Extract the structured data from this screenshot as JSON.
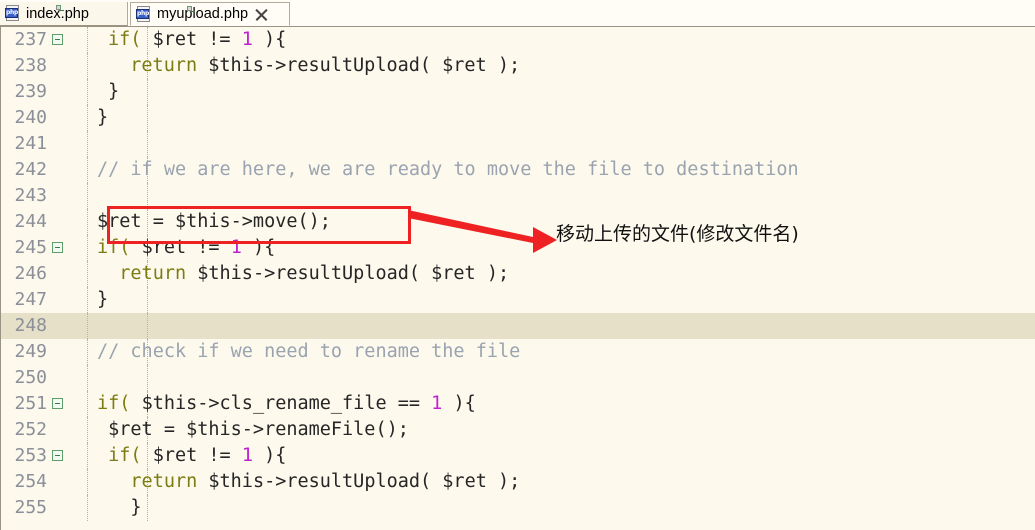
{
  "tabs": [
    {
      "label": "index.php",
      "icon": "php-file-icon",
      "active": false,
      "closable": false
    },
    {
      "label": "myupload.php",
      "icon": "php-file-icon",
      "active": true,
      "closable": true,
      "close_icon": "close-icon"
    }
  ],
  "icon_badge_text": "php",
  "editor": {
    "language": "php",
    "first_line": 237,
    "highlighted_line": 248,
    "colors": {
      "background": "#fdf9ed",
      "highlight_row": "#e7e0c9",
      "line_number": "#8a8f99",
      "keyword": "#7c7c13",
      "number": "#c020d0",
      "comment": "#9aa3b0",
      "plain": "#262626",
      "fold_marker": "#5f9e6a"
    },
    "lines": [
      {
        "n": "237",
        "fold": true,
        "hl": false,
        "indent": 1,
        "tokens": [
          {
            "t": "if( ",
            "c": "kw"
          },
          {
            "t": "$ret ",
            "c": "pl"
          },
          {
            "t": "!= ",
            "c": "pl"
          },
          {
            "t": "1",
            "c": "num"
          },
          {
            "t": " ){",
            "c": "pl"
          }
        ]
      },
      {
        "n": "238",
        "fold": false,
        "hl": false,
        "indent": 1,
        "tokens": [
          {
            "t": "  ",
            "c": "pl"
          },
          {
            "t": "return ",
            "c": "kw"
          },
          {
            "t": "$this->resultUpload( $ret );",
            "c": "pl"
          }
        ]
      },
      {
        "n": "239",
        "fold": false,
        "hl": false,
        "indent": 1,
        "tokens": [
          {
            "t": "}",
            "c": "pl"
          }
        ]
      },
      {
        "n": "240",
        "fold": false,
        "hl": false,
        "indent": 0,
        "tokens": [
          {
            "t": "}",
            "c": "pl"
          }
        ]
      },
      {
        "n": "241",
        "fold": false,
        "hl": false,
        "indent": 0,
        "tokens": [
          {
            "t": "",
            "c": "pl"
          }
        ]
      },
      {
        "n": "242",
        "fold": false,
        "hl": false,
        "indent": 0,
        "tokens": [
          {
            "t": "// if we are here, we are ready to move the file to destination",
            "c": "cmt"
          }
        ]
      },
      {
        "n": "243",
        "fold": false,
        "hl": false,
        "indent": 0,
        "tokens": [
          {
            "t": "",
            "c": "pl"
          }
        ]
      },
      {
        "n": "244",
        "fold": false,
        "hl": false,
        "indent": 0,
        "tokens": [
          {
            "t": "$ret = $this->move();",
            "c": "pl"
          }
        ]
      },
      {
        "n": "245",
        "fold": true,
        "hl": false,
        "indent": 0,
        "tokens": [
          {
            "t": "if( ",
            "c": "kw"
          },
          {
            "t": "$ret ",
            "c": "pl"
          },
          {
            "t": "!= ",
            "c": "pl"
          },
          {
            "t": "1",
            "c": "num"
          },
          {
            "t": " ){",
            "c": "pl"
          }
        ]
      },
      {
        "n": "246",
        "fold": false,
        "hl": false,
        "indent": 0,
        "tokens": [
          {
            "t": "  ",
            "c": "pl"
          },
          {
            "t": "return ",
            "c": "kw"
          },
          {
            "t": "$this->resultUpload( $ret );",
            "c": "pl"
          }
        ]
      },
      {
        "n": "247",
        "fold": false,
        "hl": false,
        "indent": 0,
        "tokens": [
          {
            "t": "}",
            "c": "pl"
          }
        ]
      },
      {
        "n": "248",
        "fold": false,
        "hl": true,
        "indent": 0,
        "tokens": [
          {
            "t": "",
            "c": "pl"
          }
        ]
      },
      {
        "n": "249",
        "fold": false,
        "hl": false,
        "indent": 0,
        "tokens": [
          {
            "t": "// check if we need to rename the file",
            "c": "cmt"
          }
        ]
      },
      {
        "n": "250",
        "fold": false,
        "hl": false,
        "indent": 0,
        "tokens": [
          {
            "t": "",
            "c": "pl"
          }
        ]
      },
      {
        "n": "251",
        "fold": true,
        "hl": false,
        "indent": 0,
        "tokens": [
          {
            "t": "if( ",
            "c": "kw"
          },
          {
            "t": "$this->cls_rename_file ",
            "c": "pl"
          },
          {
            "t": "== ",
            "c": "pl"
          },
          {
            "t": "1",
            "c": "num"
          },
          {
            "t": " ){",
            "c": "pl"
          }
        ]
      },
      {
        "n": "252",
        "fold": false,
        "hl": false,
        "indent": 0,
        "tokens": [
          {
            "t": " $ret = $this->renameFile();",
            "c": "pl"
          }
        ]
      },
      {
        "n": "253",
        "fold": true,
        "hl": false,
        "indent": 0,
        "tokens": [
          {
            "t": " ",
            "c": "pl"
          },
          {
            "t": "if( ",
            "c": "kw"
          },
          {
            "t": "$ret ",
            "c": "pl"
          },
          {
            "t": "!= ",
            "c": "pl"
          },
          {
            "t": "1",
            "c": "num"
          },
          {
            "t": " ){",
            "c": "pl"
          }
        ]
      },
      {
        "n": "254",
        "fold": false,
        "hl": false,
        "indent": 0,
        "tokens": [
          {
            "t": "   ",
            "c": "pl"
          },
          {
            "t": "return ",
            "c": "kw"
          },
          {
            "t": "$this->resultUpload( $ret );",
            "c": "pl"
          }
        ]
      },
      {
        "n": "255",
        "fold": false,
        "hl": false,
        "indent": 0,
        "tokens": [
          {
            "t": "   }",
            "c": "pl"
          }
        ]
      }
    ]
  },
  "annotation": {
    "box_color": "#ee2222",
    "arrow_color": "#ee2222",
    "arrow_icon": "right-arrow-icon",
    "note_text": "移动上传的文件(修改文件名)",
    "highlighted_code": "$ret = $this->move();"
  }
}
